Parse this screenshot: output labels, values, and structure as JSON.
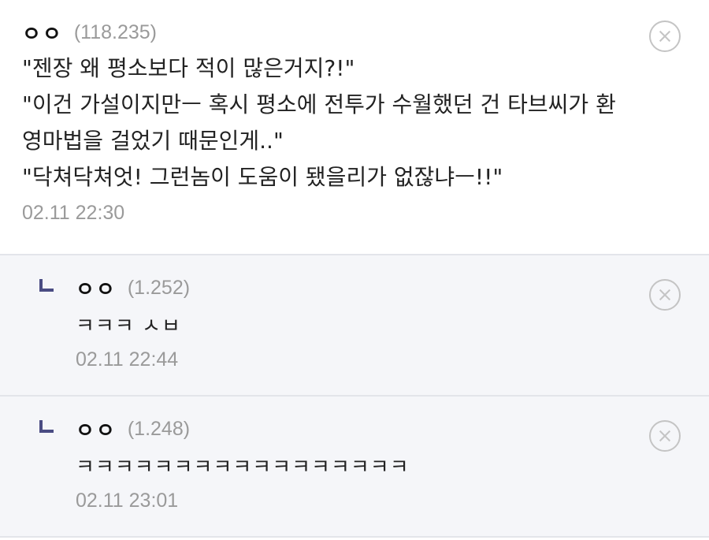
{
  "comments": [
    {
      "nick": "ㅇㅇ",
      "ip": "(118.235)",
      "lines": [
        "\"젠장 왜 평소보다 적이 많은거지?!\"",
        "\"이건 가설이지만ㅡ 혹시 평소에 전투가 수월했던 건 타브씨가 환",
        "영마법을 걸었기 때문인게..\"",
        "\"닥쳐닥쳐엇! 그런놈이 도움이 됐을리가 없잖냐ㅡ!!\""
      ],
      "date": "02.11 22:30"
    }
  ],
  "replies": [
    {
      "nick": "ㅇㅇ",
      "ip": "(1.252)",
      "lines": [
        "ㅋㅋㅋ ㅅㅂ"
      ],
      "date": "02.11 22:44"
    },
    {
      "nick": "ㅇㅇ",
      "ip": "(1.248)",
      "lines": [
        "ㅋㅋㅋㅋㅋㅋㅋㅋㅋㅋㅋㅋㅋㅋㅋㅋㅋ"
      ],
      "date": "02.11 23:01"
    }
  ],
  "icons": {
    "delete": "close-circle-icon",
    "reply_marker": "reply-arrow-icon"
  },
  "colors": {
    "reply_marker": "#4a4c83",
    "reply_background": "#f5f6f9",
    "meta_text": "#9a9a9a"
  }
}
